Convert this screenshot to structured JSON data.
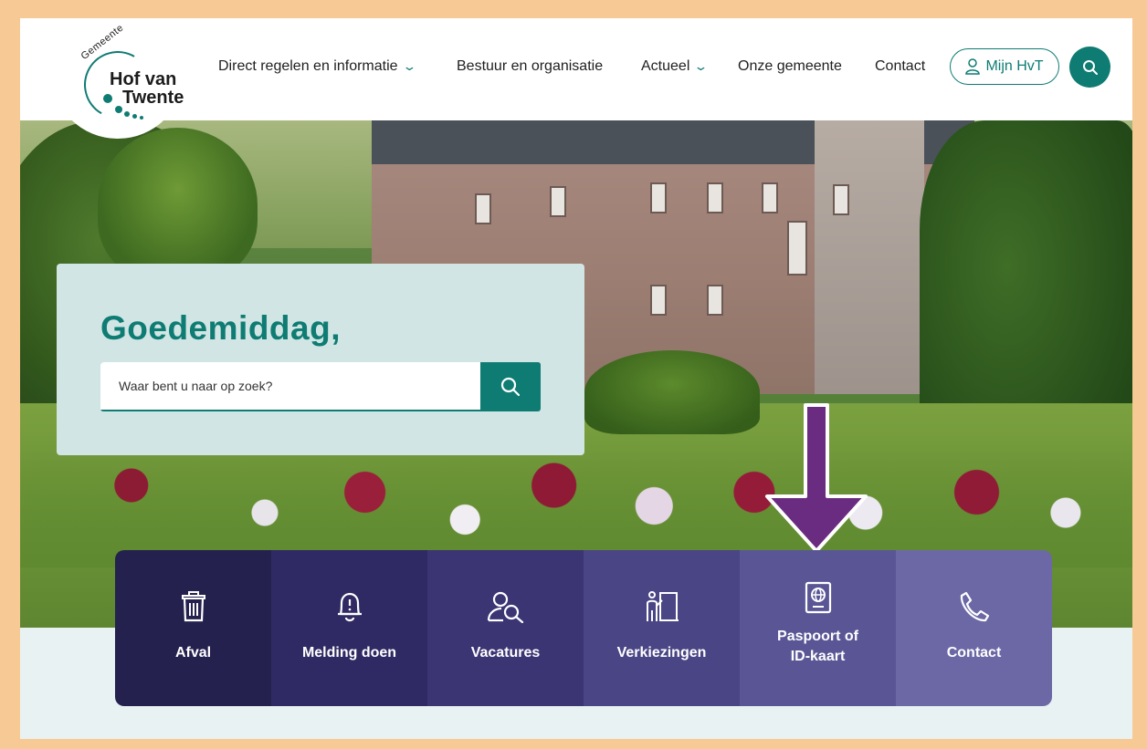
{
  "header": {
    "logo": {
      "small_text": "Gemeente",
      "line1": "Hof van",
      "line2": "Twente"
    },
    "nav": [
      {
        "label": "Direct regelen en informatie",
        "has_dropdown": true
      },
      {
        "label": "Bestuur en organisatie",
        "has_dropdown": false
      },
      {
        "label": "Actueel",
        "has_dropdown": true
      },
      {
        "label": "Onze gemeente",
        "has_dropdown": false
      },
      {
        "label": "Contact",
        "has_dropdown": false
      }
    ],
    "account_button": "Mijn HvT",
    "search_icon": "search-icon"
  },
  "greeting": {
    "title": "Goedemiddag,",
    "search_placeholder": "Waar bent u naar op zoek?"
  },
  "tiles": [
    {
      "label": "Afval",
      "icon": "trash-icon",
      "color": "#25214f"
    },
    {
      "label": "Melding doen",
      "icon": "bell-alert-icon",
      "color": "#2f2a63"
    },
    {
      "label": "Vacatures",
      "icon": "user-search-icon",
      "color": "#3b3574"
    },
    {
      "label": "Verkiezingen",
      "icon": "ballot-box-icon",
      "color": "#4a4585"
    },
    {
      "label": "Paspoort of\nID-kaart",
      "label_line1": "Paspoort of",
      "label_line2": "ID-kaart",
      "icon": "passport-icon",
      "color": "#5a5696"
    },
    {
      "label": "Contact",
      "icon": "phone-icon",
      "color": "#6c68a6"
    }
  ],
  "colors": {
    "brand_teal": "#0e7c73",
    "arrow_purple": "#6a2c80",
    "frame_border": "#f6c995"
  }
}
